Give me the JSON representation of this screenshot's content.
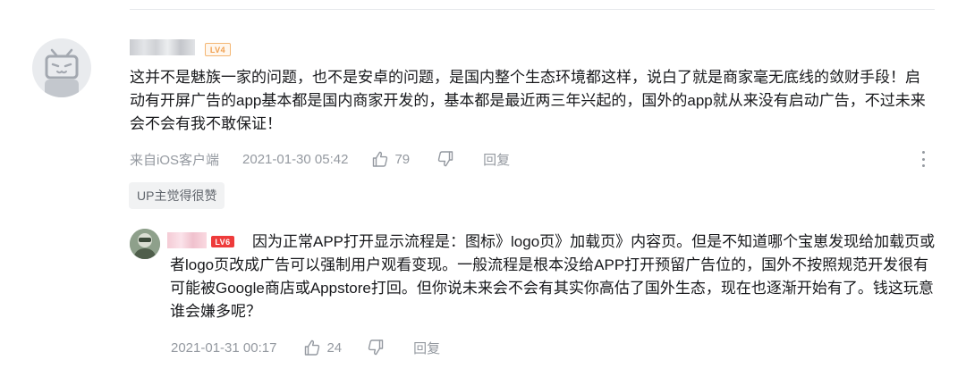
{
  "comment": {
    "level": "LV4",
    "text": "这并不是魅族一家的问题，也不是安卓的问题，是国内整个生态环境都这样，说白了就是商家毫无底线的敛财手段！启动有开屏广告的app基本都是国内商家开发的，基本都是最近两三年兴起的，国外的app就从来没有启动广告，不过未来会不会有我不敢保证！",
    "source": "来自iOS客户端",
    "timestamp": "2021-01-30 05:42",
    "like_count": "79",
    "reply_label": "回复",
    "up_badge": "UP主觉得很赞"
  },
  "reply": {
    "level": "LV6",
    "text": "因为正常APP打开显示流程是：图标》logo页》加载页》内容页。但是不知道哪个宝崽发现给加载页或者logo页改成广告可以强制用户观看变现。一般流程是根本没给APP打开预留广告位的，国外不按照规范开发很有可能被Google商店或Appstore打回。但你说未来会不会有其实你高估了国外生态，现在也逐渐开始有了。钱这玩意谁会嫌多呢？",
    "timestamp": "2021-01-31 00:17",
    "like_count": "24",
    "reply_label": "回复"
  },
  "icons": {
    "avatar_default": "bilibili-tv-icon",
    "like": "thumb-up-icon",
    "dislike": "thumb-down-icon",
    "more": "more-vertical-icon"
  },
  "colors": {
    "text": "#18191c",
    "meta": "#9499a0",
    "lv4": "#f0a050",
    "lv6": "#ee3b3b",
    "badge_bg": "#f1f2f3"
  }
}
